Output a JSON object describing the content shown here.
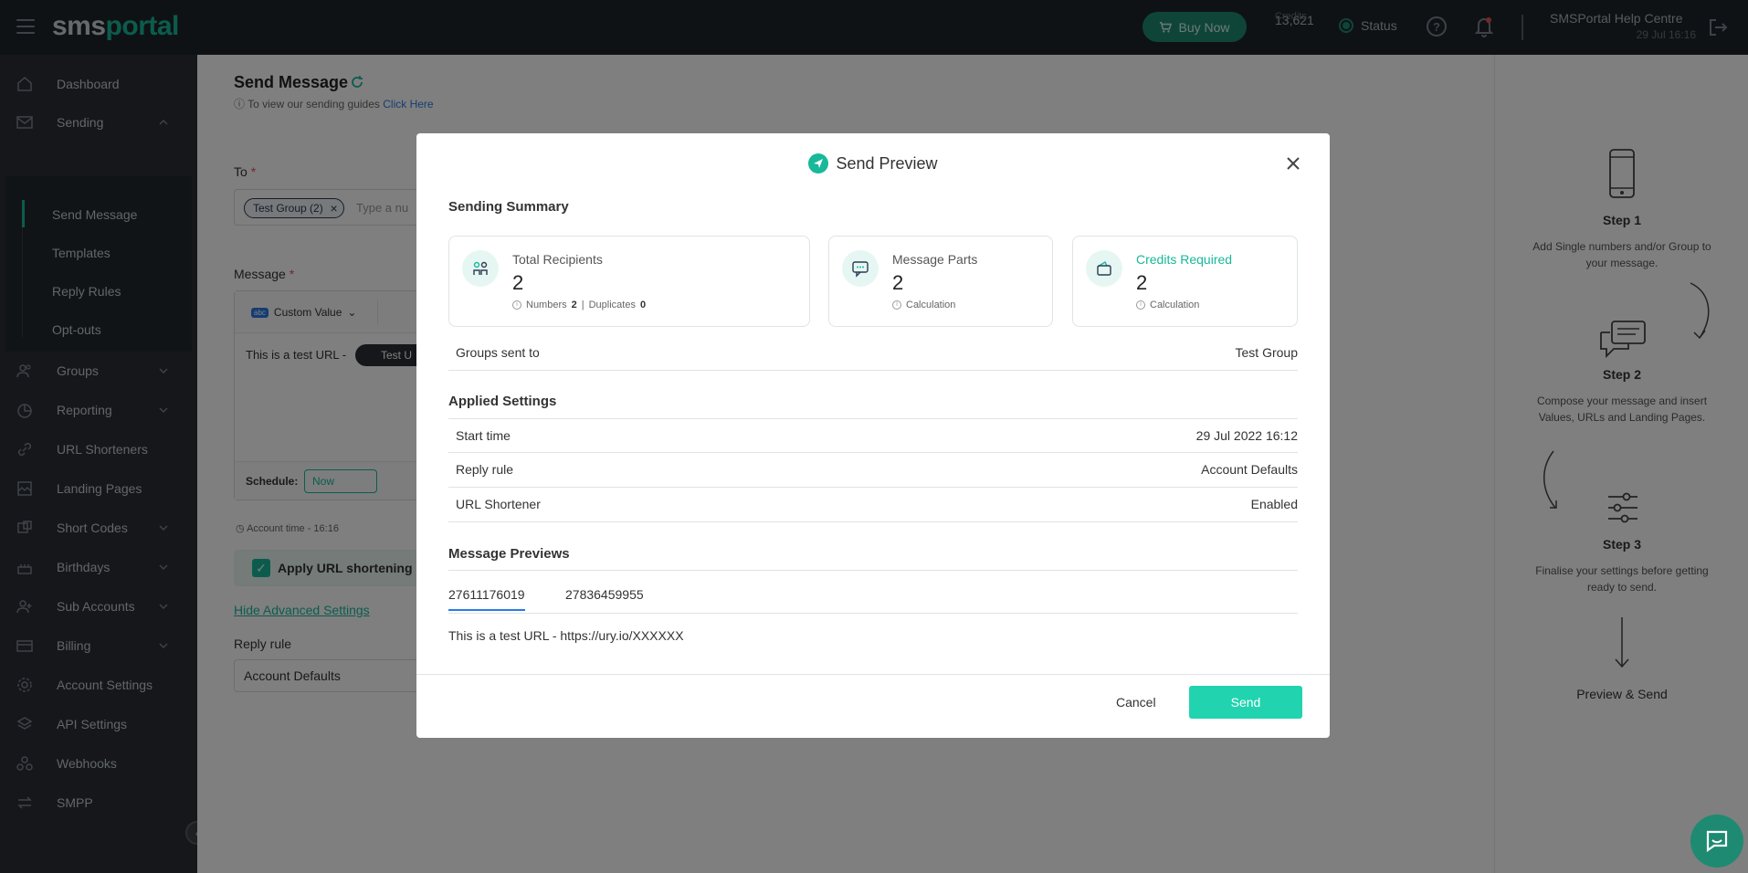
{
  "topbar": {
    "logo_part1": "sms",
    "logo_part2": "portal",
    "buy_now": "Buy Now",
    "credits_label": "Credits",
    "credits_value": "13,621",
    "status": "Status",
    "help_centre": "SMSPortal Help Centre",
    "datetime": "29 Jul 16:16"
  },
  "sidebar": {
    "items": [
      {
        "label": "Dashboard"
      },
      {
        "label": "Sending"
      },
      {
        "label": "Groups"
      },
      {
        "label": "Reporting"
      },
      {
        "label": "URL Shorteners"
      },
      {
        "label": "Landing Pages"
      },
      {
        "label": "Short Codes"
      },
      {
        "label": "Birthdays"
      },
      {
        "label": "Sub Accounts"
      },
      {
        "label": "Billing"
      },
      {
        "label": "Account Settings"
      },
      {
        "label": "API Settings"
      },
      {
        "label": "Webhooks"
      },
      {
        "label": "SMPP"
      }
    ],
    "sub_items": [
      {
        "label": "Send Message"
      },
      {
        "label": "Templates"
      },
      {
        "label": "Reply Rules"
      },
      {
        "label": "Opt-outs"
      }
    ]
  },
  "page": {
    "title": "Send Message",
    "guide_text": "To view our sending guides",
    "guide_link": "Click Here",
    "to_label": "To",
    "to_chip": "Test Group (2)",
    "to_placeholder": "Type a nu",
    "message_label": "Message",
    "custom_value_tag": "abc",
    "custom_value": "Custom Value",
    "message_text": "This is a test URL -",
    "url_chip": "Test U",
    "schedule_label": "Schedule:",
    "schedule_value": "Now",
    "account_time": "Account time - 16:16",
    "apply_url": "Apply URL shortening ru",
    "hide_advanced": "Hide Advanced Settings",
    "reply_rule_label": "Reply rule",
    "reply_rule_value": "Account Defaults"
  },
  "steps": [
    {
      "title": "Step 1",
      "desc": "Add Single numbers and/or Group to your message."
    },
    {
      "title": "Step 2",
      "desc": "Compose your message and insert Values, URLs and Landing Pages."
    },
    {
      "title": "Step 3",
      "desc": "Finalise your settings before getting ready to send."
    },
    {
      "title": "Preview & Send",
      "desc": ""
    }
  ],
  "modal": {
    "title": "Send Preview",
    "sending_summary": "Sending Summary",
    "cards": {
      "recipients": {
        "title": "Total Recipients",
        "value": "2",
        "numbers_label": "Numbers",
        "numbers": "2",
        "sep": "|",
        "duplicates_label": "Duplicates",
        "duplicates": "0"
      },
      "parts": {
        "title": "Message Parts",
        "value": "2",
        "note": "Calculation"
      },
      "credits": {
        "title": "Credits Required",
        "value": "2",
        "note": "Calculation"
      }
    },
    "groups_sent_to_label": "Groups sent to",
    "groups_sent_to_value": "Test Group",
    "applied_settings": "Applied Settings",
    "settings": [
      {
        "key": "Start time",
        "value": "29 Jul 2022 16:12"
      },
      {
        "key": "Reply rule",
        "value": "Account Defaults"
      },
      {
        "key": "URL Shortener",
        "value": "Enabled"
      }
    ],
    "message_previews": "Message Previews",
    "tabs": [
      "27611176019",
      "27836459955"
    ],
    "preview_text": "This is a test URL - https://ury.io/XXXXXX",
    "cancel": "Cancel",
    "send": "Send"
  },
  "colors": {
    "accent": "#18b89a",
    "send_button": "#22d3b0",
    "topbar": "#1f2428",
    "sidebar": "#2a2f34"
  }
}
